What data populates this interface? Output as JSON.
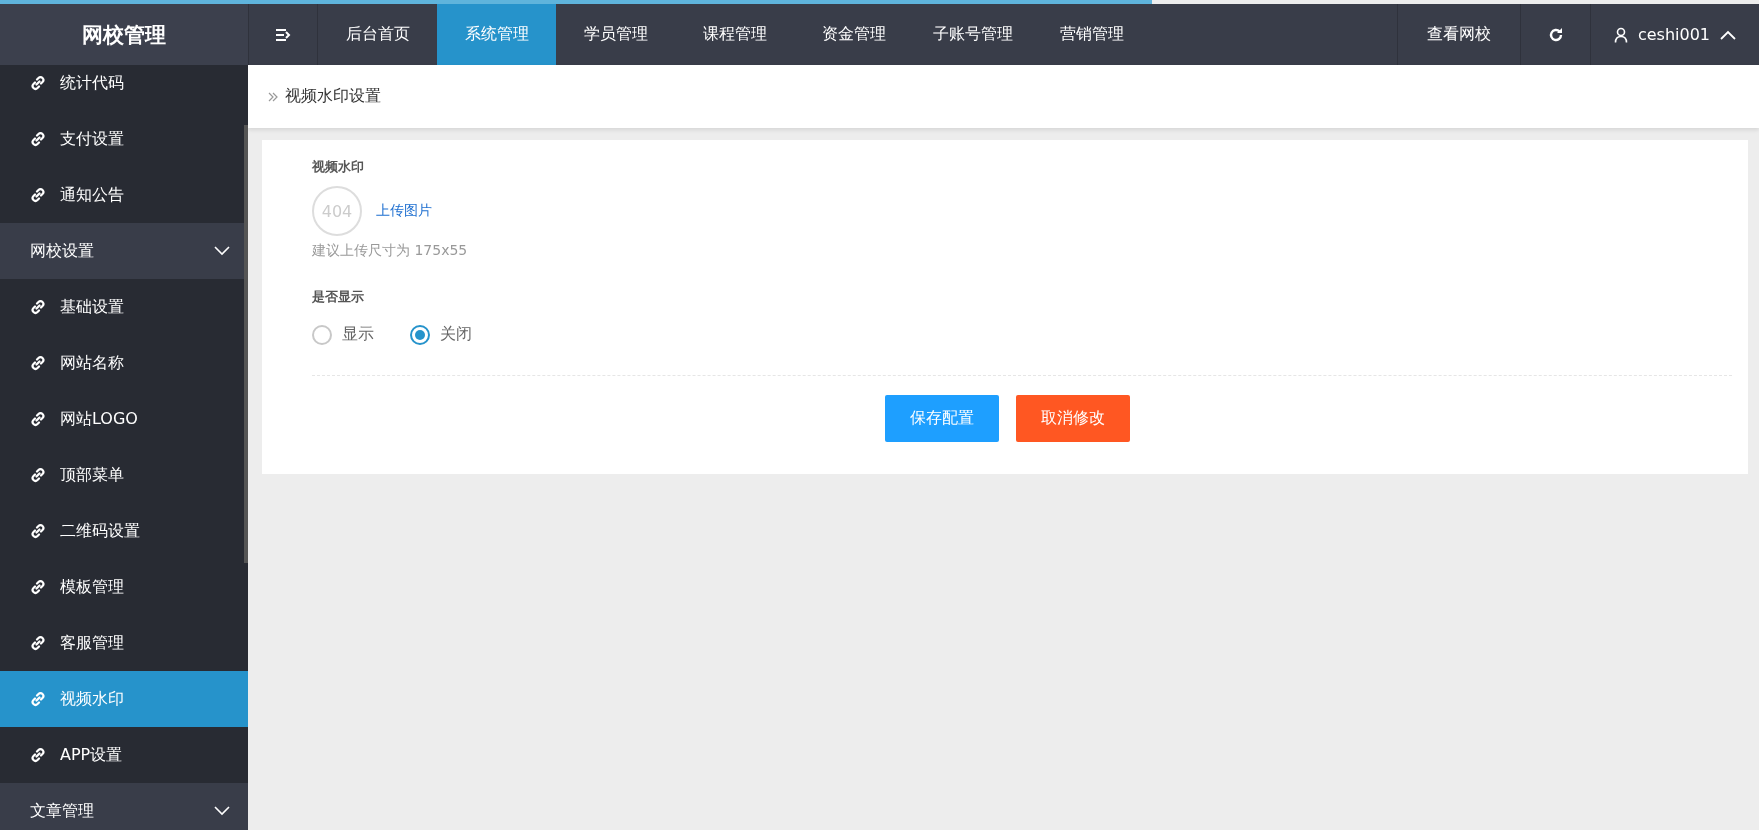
{
  "loading_bar": {
    "level": 0.655
  },
  "logo": "网校管理",
  "top_nav": [
    {
      "label": "后台首页",
      "selected": false
    },
    {
      "label": "系统管理",
      "selected": true
    },
    {
      "label": "学员管理",
      "selected": false
    },
    {
      "label": "课程管理",
      "selected": false
    },
    {
      "label": "资金管理",
      "selected": false
    },
    {
      "label": "子账号管理",
      "selected": false
    },
    {
      "label": "营销管理",
      "selected": false
    }
  ],
  "header_right": {
    "view_site": "查看网校",
    "user": "ceshi001"
  },
  "sidebar": {
    "items": [
      {
        "kind": "link",
        "label": "统计代码",
        "selected": false
      },
      {
        "kind": "link",
        "label": "支付设置",
        "selected": false
      },
      {
        "kind": "link",
        "label": "通知公告",
        "selected": false
      },
      {
        "kind": "group",
        "label": "网校设置",
        "children": [
          {
            "kind": "link",
            "label": "基础设置",
            "selected": false
          },
          {
            "kind": "link",
            "label": "网站名称",
            "selected": false
          },
          {
            "kind": "link",
            "label": "网站LOGO",
            "selected": false
          },
          {
            "kind": "link",
            "label": "顶部菜单",
            "selected": false
          },
          {
            "kind": "link",
            "label": "二维码设置",
            "selected": false
          },
          {
            "kind": "link",
            "label": "模板管理",
            "selected": false
          },
          {
            "kind": "link",
            "label": "客服管理",
            "selected": false
          },
          {
            "kind": "link",
            "label": "视频水印",
            "selected": true
          },
          {
            "kind": "link",
            "label": "APP设置",
            "selected": false
          }
        ]
      },
      {
        "kind": "group",
        "label": "文章管理"
      }
    ]
  },
  "breadcrumb": "视频水印设置",
  "form": {
    "watermark_label": "视频水印",
    "image_placeholder": "404",
    "upload_link": "上传图片",
    "hint": "建议上传尺寸为 175x55",
    "display_label": "是否显示",
    "display_options": [
      {
        "label": "显示",
        "selected": false
      },
      {
        "label": "关闭",
        "selected": true
      }
    ],
    "buttons": [
      {
        "label": "保存配置",
        "kind": "primary"
      },
      {
        "label": "取消修改",
        "kind": "danger"
      }
    ]
  }
}
